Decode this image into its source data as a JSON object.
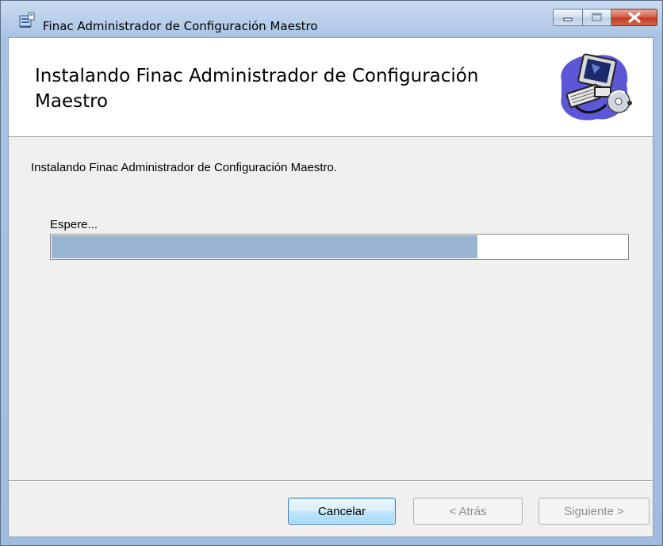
{
  "window": {
    "title": "Finac Administrador de Configuración Maestro"
  },
  "banner": {
    "title": "Instalando Finac Administrador de Configuración Maestro"
  },
  "main": {
    "status_text": "Instalando Finac Administrador de Configuración Maestro.",
    "wait_label": "Espere...",
    "progress_fraction": 0.74
  },
  "buttons": {
    "cancel": "Cancelar",
    "back": "< Atrás",
    "next": "Siguiente >"
  },
  "colors": {
    "progress_fill": "#99b4d1",
    "banner_background": "#ffffff",
    "dialog_background": "#f0f0f0"
  },
  "icons": {
    "app": "installer-package-icon",
    "banner": "computer-cd-icon"
  }
}
